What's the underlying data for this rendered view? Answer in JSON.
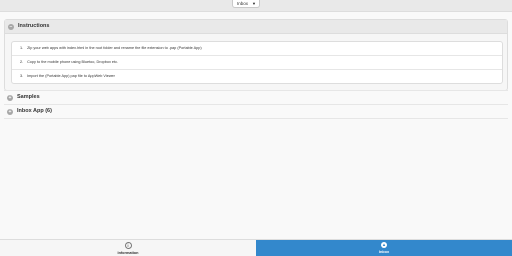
{
  "header": {
    "select_value": "Inbox"
  },
  "instructions": {
    "title": "Instructions",
    "steps": [
      {
        "num": "1.",
        "text": "Zip your web apps with index.html in the root folder and rename the file extension to .pap (Portable App)"
      },
      {
        "num": "2.",
        "text": "Copy to the mobile phone using Bluetoo, Dropbox etc."
      },
      {
        "num": "3.",
        "text": "Import the (Portable App) pap file to AppWeb Viewer"
      }
    ]
  },
  "samples": {
    "title": "Samples"
  },
  "inbox": {
    "title": "Inbox App (6)"
  },
  "nav": {
    "info": {
      "label": "Information",
      "icon": "info-icon"
    },
    "inbox": {
      "label": "Inbox",
      "icon": "inbox-icon"
    }
  },
  "colors": {
    "accent": "#3388cc"
  }
}
